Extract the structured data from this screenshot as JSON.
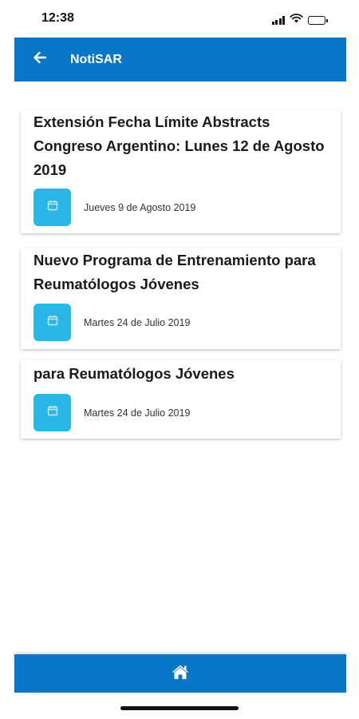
{
  "status_bar": {
    "time": "12:38",
    "icons": [
      "signal-icon",
      "wifi-icon",
      "battery-icon"
    ]
  },
  "app_bar": {
    "title": "NotiSAR",
    "back_icon": "arrow-left-icon",
    "color": "#0a76c8"
  },
  "news": [
    {
      "title": "Extensión Fecha Límite Abstracts Congreso Argentino: Lunes 12 de Agosto 2019",
      "date": "Jueves 9 de Agosto 2019",
      "icon": "calendar-icon"
    },
    {
      "title": "Nuevo Programa de Entrenamiento para Reumatólogos Jóvenes",
      "date": "Martes 24 de Julio 2019",
      "icon": "calendar-icon"
    },
    {
      "title": "para Reumatólogos Jóvenes",
      "date": "Martes 24 de Julio 2019",
      "icon": "calendar-icon"
    }
  ],
  "bottom_bar": {
    "icon": "home-icon",
    "color": "#0a76c8"
  },
  "colors": {
    "primary": "#0a76c8",
    "calendar_badge": "#2bb6e8"
  }
}
